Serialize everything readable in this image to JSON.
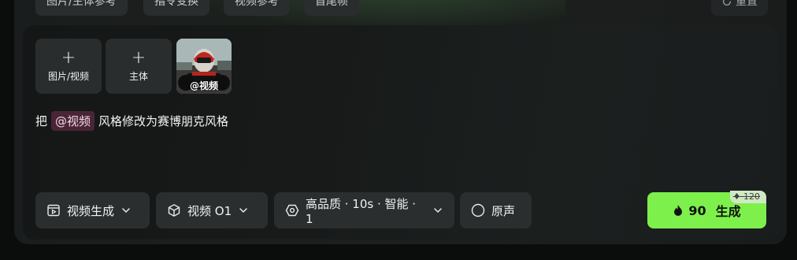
{
  "top_tabs": {
    "items": [
      "图片/主体参考",
      "指令变换",
      "视频参考",
      "首尾帧"
    ],
    "reset_label": "重置"
  },
  "attachments": {
    "image_video_label": "图片/视频",
    "subject_label": "主体",
    "video_thumb_label": "@视频"
  },
  "prompt": {
    "prefix": "把",
    "mention": "@视频",
    "suffix": "风格修改为赛博朋克风格"
  },
  "toolbar": {
    "mode_label": "视频生成",
    "model_label": "视频 O1",
    "settings_label": "高品质 · 10s · 智能 · 1",
    "audio_label": "原声"
  },
  "generate": {
    "cost": "90",
    "label": "生成",
    "original_cost": "120"
  },
  "colors": {
    "accent": "#7ef04b",
    "mention_bg": "#4a2536",
    "panel_bg": "#171a19"
  }
}
